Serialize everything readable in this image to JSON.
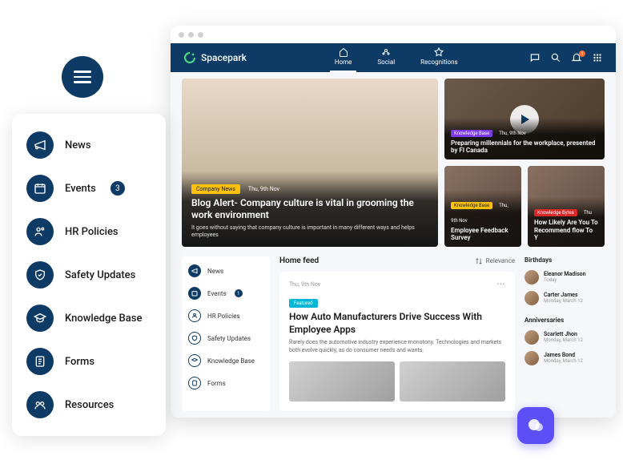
{
  "brand": {
    "name": "Spacepark"
  },
  "topnav": [
    {
      "label": "Home",
      "active": true
    },
    {
      "label": "Social",
      "active": false
    },
    {
      "label": "Recognitions",
      "active": false
    }
  ],
  "notif_count": "1",
  "popout": [
    {
      "label": "News",
      "icon": "megaphone",
      "badge": null
    },
    {
      "label": "Events",
      "icon": "calendar",
      "badge": "3"
    },
    {
      "label": "HR Policies",
      "icon": "people",
      "badge": null
    },
    {
      "label": "Safety Updates",
      "icon": "shield",
      "badge": null
    },
    {
      "label": "Knowledge Base",
      "icon": "cap",
      "badge": null
    },
    {
      "label": "Forms",
      "icon": "list",
      "badge": null
    },
    {
      "label": "Resources",
      "icon": "group",
      "badge": null
    }
  ],
  "hero": {
    "tag": "Company News",
    "date": "Thu, 9th Nov",
    "title": "Blog Alert- Company culture is vital in grooming the work environment",
    "desc": "It goes without saying that company culture is important in many different ways and helps employees"
  },
  "side_top": {
    "tag": "Knowledge Base",
    "date": "Thu, 9th Nov",
    "title": "Preparing millennials for the workplace, presented by Fl Canada"
  },
  "side_left": {
    "tag": "Knowledge Base",
    "date": "Thu, 9th Nov",
    "title": "Employee Feedback Survey"
  },
  "side_right": {
    "tag": "Knowledge Bytes",
    "date": "Thu",
    "title": "How Likely Are You To Recommend flow To Y"
  },
  "inner_nav": [
    {
      "label": "News",
      "icon": "megaphone",
      "filled": true,
      "badge": null
    },
    {
      "label": "Events",
      "icon": "calendar",
      "filled": true,
      "badge": "1"
    },
    {
      "label": "HR Policies",
      "icon": "people",
      "filled": false,
      "badge": null
    },
    {
      "label": "Safety Updates",
      "icon": "shield",
      "filled": false,
      "badge": null
    },
    {
      "label": "Knowledge Base",
      "icon": "cap",
      "filled": false,
      "badge": null
    },
    {
      "label": "Forms",
      "icon": "list",
      "filled": false,
      "badge": null
    }
  ],
  "feed": {
    "heading": "Home feed",
    "sort": "Relevance",
    "date": "Thu, 9th Nov",
    "tag": "Featured",
    "title": "How Auto Manufacturers Drive Success With Employee Apps",
    "desc": "Rarely does the automotive industry experience monotony. Technologies and markets both evolve quickly, as do consumer needs and wants."
  },
  "birthdays": {
    "heading": "Birthdays",
    "items": [
      {
        "name": "Eleanor Madison",
        "meta": "Today"
      },
      {
        "name": "Carter James",
        "meta": "Monday, March 12"
      }
    ]
  },
  "anniversaries": {
    "heading": "Anniversaries",
    "items": [
      {
        "name": "Scarlett Jhon",
        "meta": "Monday, March 12"
      },
      {
        "name": "James Bond",
        "meta": "Monday, March 12"
      }
    ]
  }
}
